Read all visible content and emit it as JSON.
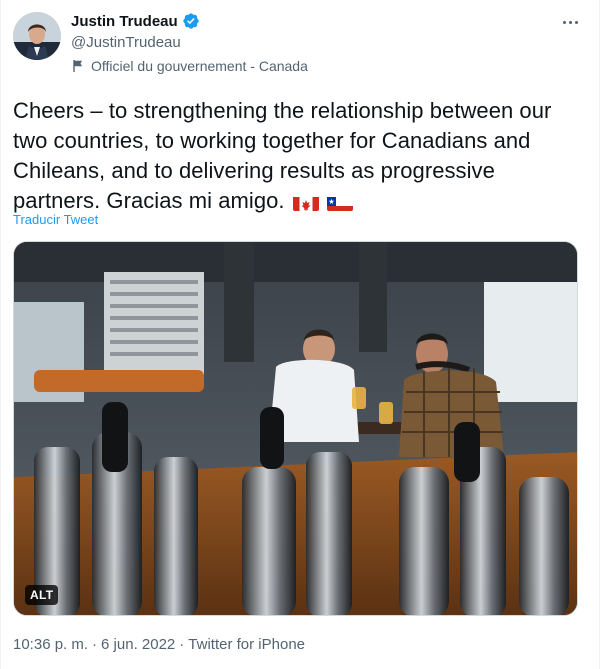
{
  "author": {
    "name": "Justin Trudeau",
    "handle": "@JustinTrudeau",
    "affiliation": "Officiel du gouvernement - Canada"
  },
  "tweet": {
    "text": "Cheers – to strengthening the relationship between our two countries, to working together for Canadians and Chileans, and to delivering results as progressive partners. Gracias mi amigo.",
    "translate_label": "Traducir Tweet"
  },
  "media": {
    "alt_badge": "ALT"
  },
  "footer": {
    "time": "10:36 p. m.",
    "sep1": "·",
    "date": "6 jun. 2022",
    "sep2": "·",
    "source": "Twitter for iPhone"
  },
  "icons": {
    "verified": "verified-badge-icon",
    "affiliation": "flag-icon",
    "more": "more-options-icon"
  },
  "colors": {
    "accent": "#1d9bf0",
    "secondary_text": "#536471"
  }
}
